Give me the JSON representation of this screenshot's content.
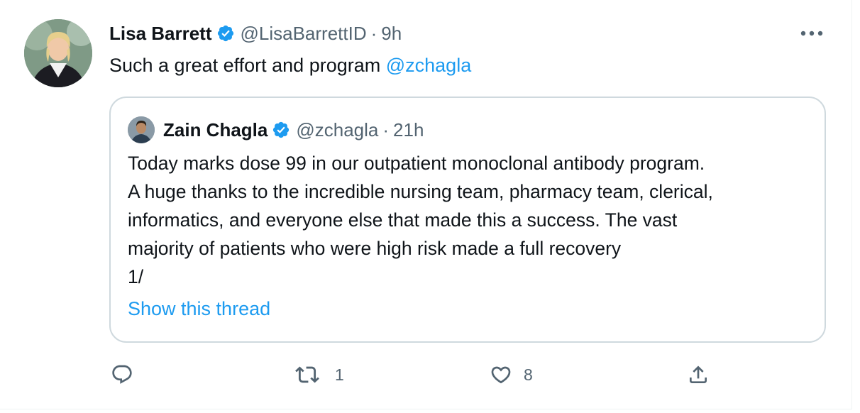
{
  "tweet": {
    "author_name": "Lisa Barrett",
    "author_handle": "@LisaBarrettID",
    "separator": "·",
    "time": "9h",
    "text_before": "Such a great effort and program ",
    "mention": "@zchagla",
    "more_icon": "more-dots-icon",
    "verified_icon": "verified-badge-icon",
    "accent_color": "#1d9bf0"
  },
  "quote": {
    "author_name": "Zain Chagla",
    "author_handle": "@zchagla",
    "separator": "·",
    "time": "21h",
    "lines": [
      "Today marks dose 99 in our outpatient monoclonal antibody program.",
      "A huge thanks to the incredible nursing team, pharmacy team, clerical,",
      "informatics, and everyone else that made this a success.  The vast",
      "majority of patients who were high risk made a full recovery",
      "1/"
    ],
    "show_thread": "Show this thread"
  },
  "actions": {
    "reply_icon": "reply-icon",
    "retweet_icon": "retweet-icon",
    "retweet_count": "1",
    "like_icon": "heart-icon",
    "like_count": "8",
    "share_icon": "share-icon"
  }
}
